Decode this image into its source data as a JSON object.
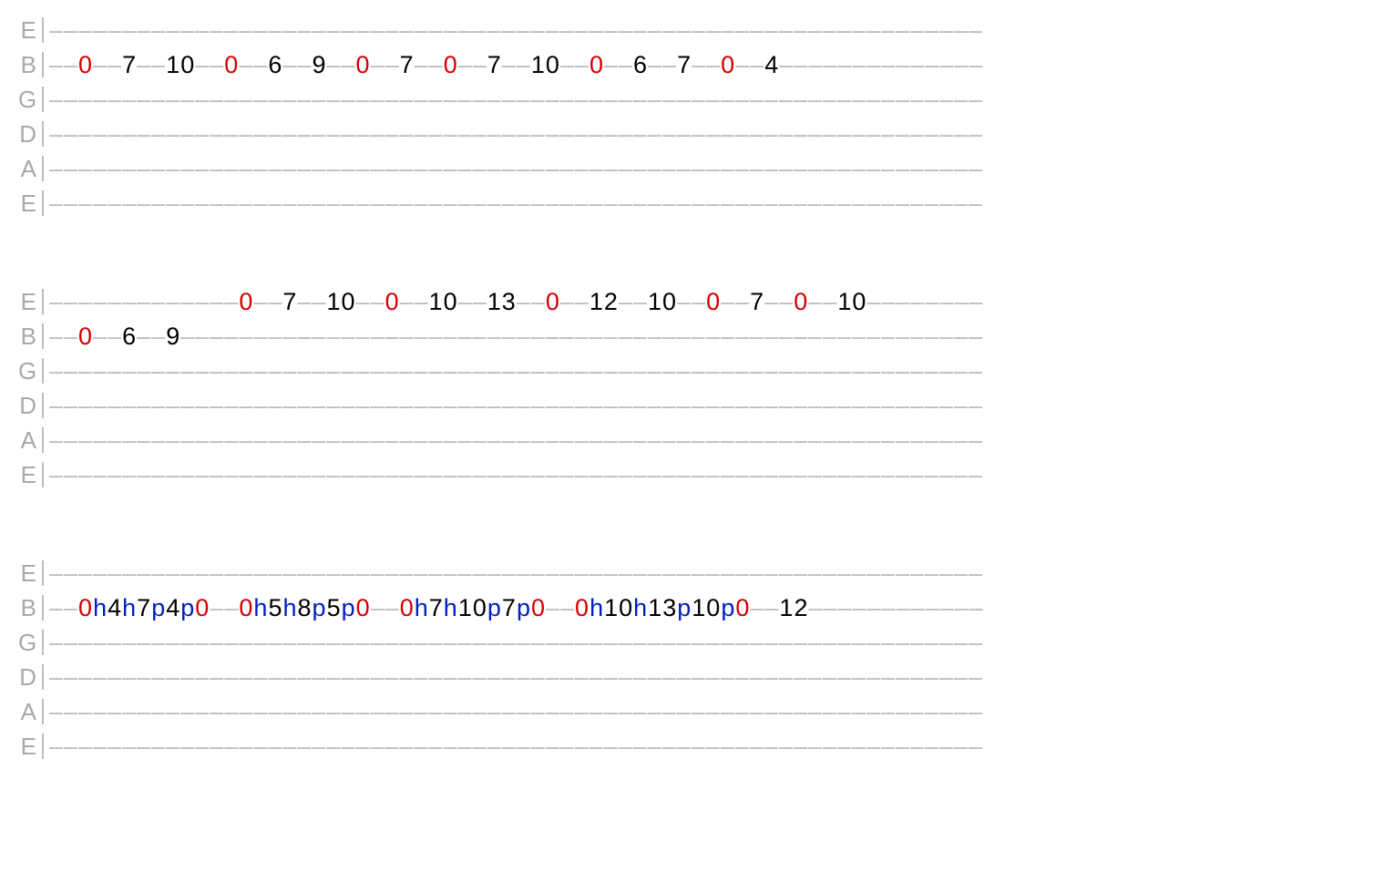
{
  "string_names": [
    "E",
    "B",
    "G",
    "D",
    "A",
    "E"
  ],
  "dash_char": "–",
  "gap_units": 2,
  "lead_units": 2,
  "trail_units": 2,
  "blocks": [
    {
      "lines": [
        [],
        [
          {
            "t": "f",
            "v": "0",
            "c": "red"
          },
          {
            "t": "g"
          },
          {
            "t": "f",
            "v": "7"
          },
          {
            "t": "g"
          },
          {
            "t": "f",
            "v": "10"
          },
          {
            "t": "g"
          },
          {
            "t": "f",
            "v": "0",
            "c": "red"
          },
          {
            "t": "g"
          },
          {
            "t": "f",
            "v": "6"
          },
          {
            "t": "g"
          },
          {
            "t": "f",
            "v": "9"
          },
          {
            "t": "g"
          },
          {
            "t": "f",
            "v": "0",
            "c": "red"
          },
          {
            "t": "g"
          },
          {
            "t": "f",
            "v": "7"
          },
          {
            "t": "g"
          },
          {
            "t": "f",
            "v": "0",
            "c": "red"
          },
          {
            "t": "g"
          },
          {
            "t": "f",
            "v": "7"
          },
          {
            "t": "g"
          },
          {
            "t": "f",
            "v": "10"
          },
          {
            "t": "g"
          },
          {
            "t": "f",
            "v": "0",
            "c": "red"
          },
          {
            "t": "g"
          },
          {
            "t": "f",
            "v": "6"
          },
          {
            "t": "g"
          },
          {
            "t": "f",
            "v": "7"
          },
          {
            "t": "g"
          },
          {
            "t": "f",
            "v": "0",
            "c": "red"
          },
          {
            "t": "g"
          },
          {
            "t": "f",
            "v": "4"
          }
        ],
        [],
        [],
        [],
        []
      ]
    },
    {
      "lines": [
        [
          {
            "t": "p",
            "w": 3
          },
          {
            "t": "g"
          },
          {
            "t": "p",
            "w": 1
          },
          {
            "t": "g"
          },
          {
            "t": "p",
            "w": 1
          },
          {
            "t": "g"
          },
          {
            "t": "f",
            "v": "0",
            "c": "red"
          },
          {
            "t": "g"
          },
          {
            "t": "f",
            "v": "7"
          },
          {
            "t": "g"
          },
          {
            "t": "f",
            "v": "10"
          },
          {
            "t": "g"
          },
          {
            "t": "f",
            "v": "0",
            "c": "red"
          },
          {
            "t": "g"
          },
          {
            "t": "f",
            "v": "10"
          },
          {
            "t": "g"
          },
          {
            "t": "f",
            "v": "13"
          },
          {
            "t": "g"
          },
          {
            "t": "f",
            "v": "0",
            "c": "red"
          },
          {
            "t": "g"
          },
          {
            "t": "f",
            "v": "12"
          },
          {
            "t": "g"
          },
          {
            "t": "f",
            "v": "10"
          },
          {
            "t": "g"
          },
          {
            "t": "f",
            "v": "0",
            "c": "red"
          },
          {
            "t": "g"
          },
          {
            "t": "f",
            "v": "7"
          },
          {
            "t": "g"
          },
          {
            "t": "f",
            "v": "0",
            "c": "red"
          },
          {
            "t": "g"
          },
          {
            "t": "f",
            "v": "10"
          }
        ],
        [
          {
            "t": "f",
            "v": "0",
            "c": "red"
          },
          {
            "t": "g"
          },
          {
            "t": "f",
            "v": "6"
          },
          {
            "t": "g"
          },
          {
            "t": "f",
            "v": "9"
          }
        ],
        [],
        [],
        [],
        []
      ]
    },
    {
      "lines": [
        [],
        [
          {
            "t": "f",
            "v": "0",
            "c": "red"
          },
          {
            "t": "x",
            "v": "h"
          },
          {
            "t": "f",
            "v": "4"
          },
          {
            "t": "x",
            "v": "h"
          },
          {
            "t": "f",
            "v": "7"
          },
          {
            "t": "x",
            "v": "p"
          },
          {
            "t": "f",
            "v": "4"
          },
          {
            "t": "x",
            "v": "p"
          },
          {
            "t": "f",
            "v": "0",
            "c": "red"
          },
          {
            "t": "g"
          },
          {
            "t": "f",
            "v": "0",
            "c": "red"
          },
          {
            "t": "x",
            "v": "h"
          },
          {
            "t": "f",
            "v": "5"
          },
          {
            "t": "x",
            "v": "h"
          },
          {
            "t": "f",
            "v": "8"
          },
          {
            "t": "x",
            "v": "p"
          },
          {
            "t": "f",
            "v": "5"
          },
          {
            "t": "x",
            "v": "p"
          },
          {
            "t": "f",
            "v": "0",
            "c": "red"
          },
          {
            "t": "g"
          },
          {
            "t": "f",
            "v": "0",
            "c": "red"
          },
          {
            "t": "x",
            "v": "h"
          },
          {
            "t": "f",
            "v": "7"
          },
          {
            "t": "x",
            "v": "h"
          },
          {
            "t": "f",
            "v": "10"
          },
          {
            "t": "x",
            "v": "p"
          },
          {
            "t": "f",
            "v": "7"
          },
          {
            "t": "x",
            "v": "p"
          },
          {
            "t": "f",
            "v": "0",
            "c": "red"
          },
          {
            "t": "g"
          },
          {
            "t": "f",
            "v": "0",
            "c": "red"
          },
          {
            "t": "x",
            "v": "h"
          },
          {
            "t": "f",
            "v": "10"
          },
          {
            "t": "x",
            "v": "h"
          },
          {
            "t": "f",
            "v": "13"
          },
          {
            "t": "x",
            "v": "p"
          },
          {
            "t": "f",
            "v": "10"
          },
          {
            "t": "x",
            "v": "p"
          },
          {
            "t": "f",
            "v": "0",
            "c": "red"
          },
          {
            "t": "g"
          },
          {
            "t": "f",
            "v": "12"
          }
        ],
        [],
        [],
        [],
        []
      ]
    }
  ]
}
